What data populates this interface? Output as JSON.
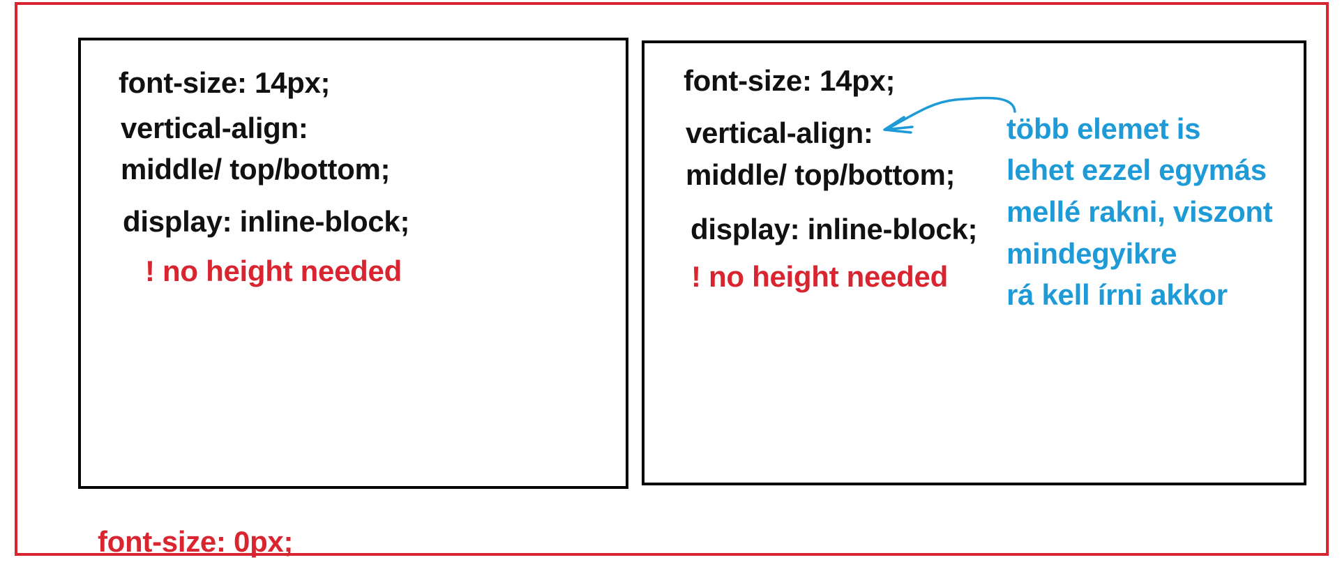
{
  "left_box": {
    "line1": "font-size: 14px;",
    "line2": "vertical-align:",
    "line3": "middle/ top/bottom;",
    "line4": "display: inline-block;",
    "note": "! no height needed"
  },
  "right_box": {
    "line1": "font-size: 14px;",
    "line2": "vertical-align:",
    "line3": "middle/ top/bottom;",
    "line4": "display: inline-block;",
    "note": "! no height needed"
  },
  "annotation": {
    "lines": [
      "több elemet is",
      "lehet ezzel egymás",
      "mellé rakni, viszont",
      "mindegyikre",
      "rá kell írni akkor"
    ]
  },
  "container_note": "font-size: 0px;",
  "colors": {
    "outer_border": "#d9252f",
    "inner_border": "#000000",
    "annotation": "#1e9bd7",
    "warning_text": "#d9252f"
  }
}
